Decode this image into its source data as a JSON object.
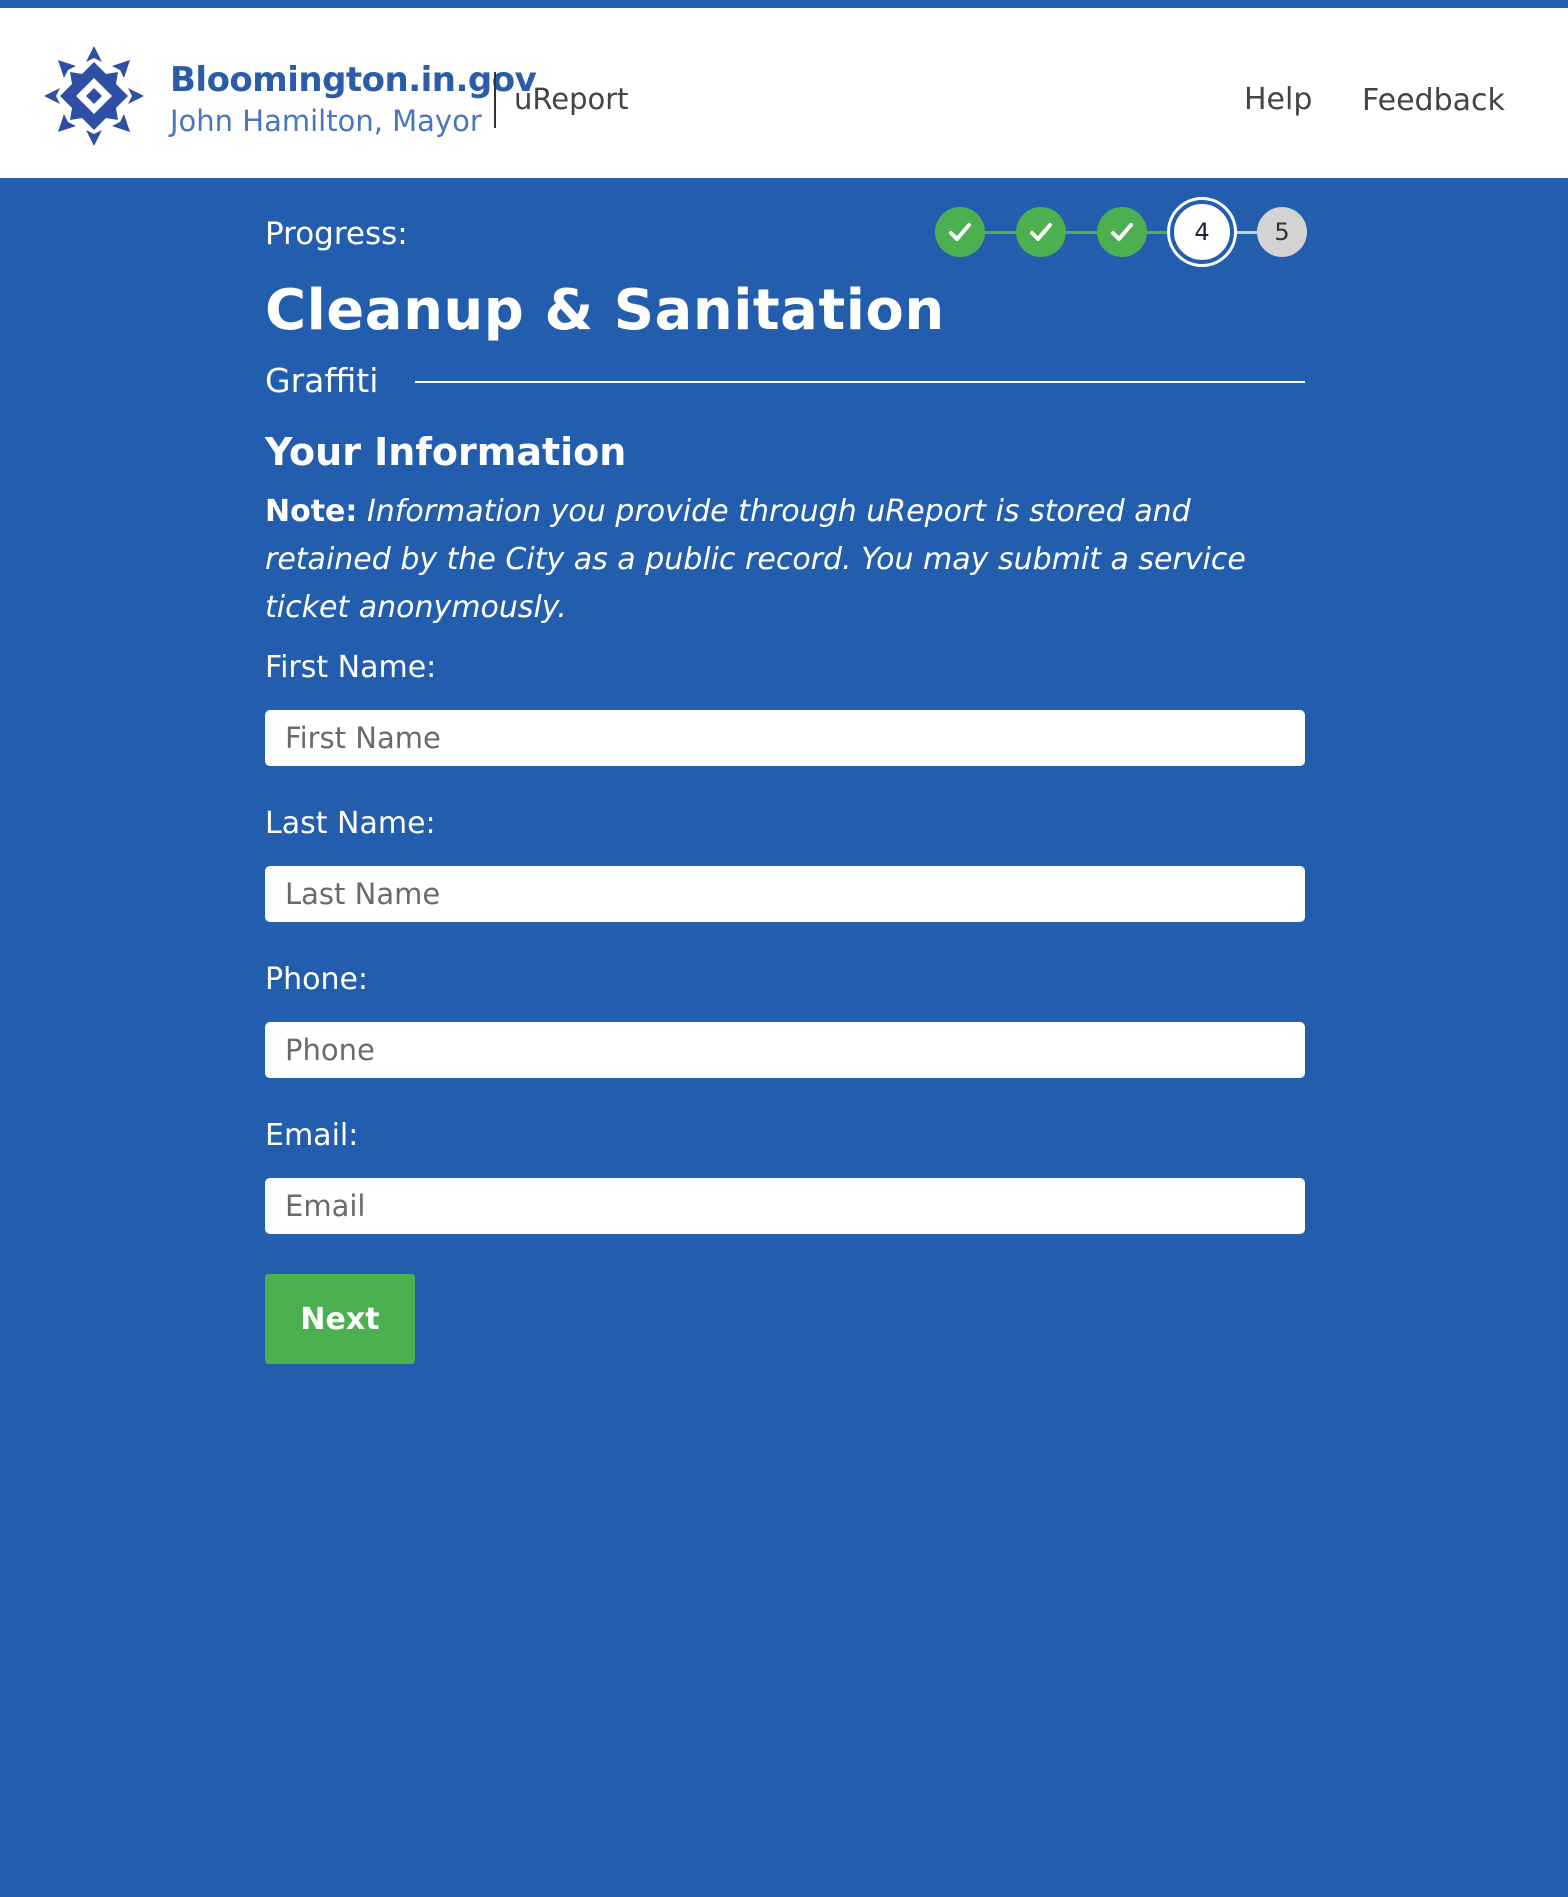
{
  "header": {
    "brand_name": "Bloomington.in.gov",
    "brand_subtitle": "John Hamilton, Mayor",
    "app_name": "uReport",
    "nav": {
      "help": "Help",
      "feedback": "Feedback"
    }
  },
  "progress": {
    "label": "Progress:",
    "steps": [
      {
        "state": "complete",
        "label": ""
      },
      {
        "state": "complete",
        "label": ""
      },
      {
        "state": "complete",
        "label": ""
      },
      {
        "state": "current",
        "label": "4"
      },
      {
        "state": "upcoming",
        "label": "5"
      }
    ]
  },
  "category": {
    "title": "Cleanup & Sanitation",
    "subcategory": "Graffiti"
  },
  "section": {
    "title": "Your Information",
    "note_label": "Note:",
    "note_text": " Information you provide through uReport is stored and retained by the City as a public record. You may submit a service ticket anonymously."
  },
  "form": {
    "first_name": {
      "label": "First Name:",
      "placeholder": "First Name",
      "value": ""
    },
    "last_name": {
      "label": "Last Name:",
      "placeholder": "Last Name",
      "value": ""
    },
    "phone": {
      "label": "Phone:",
      "placeholder": "Phone",
      "value": ""
    },
    "email": {
      "label": "Email:",
      "placeholder": "Email",
      "value": ""
    },
    "next_label": "Next"
  },
  "colors": {
    "primary_blue": "#225ead",
    "success_green": "#4caf50",
    "pending_gray": "#d3d3d3"
  }
}
